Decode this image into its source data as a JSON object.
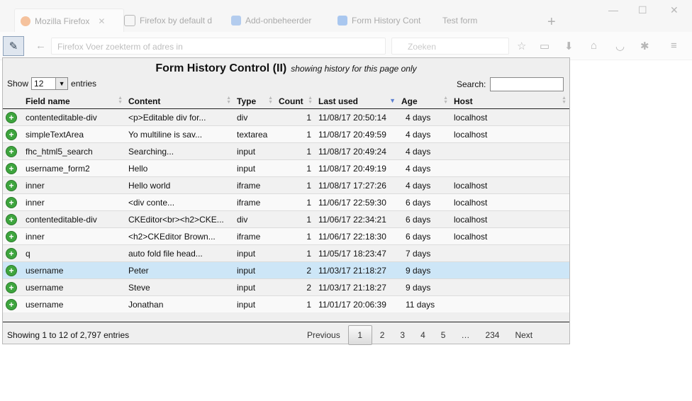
{
  "browser": {
    "tabs": [
      {
        "label": "Mozilla Firefox",
        "icon": "firefox-icon",
        "color": "#e66000"
      },
      {
        "label": "Firefox by default d",
        "icon": "page-icon",
        "color": "#444444"
      },
      {
        "label": "Add-onbeheerder",
        "icon": "puzzle-icon",
        "color": "#3a7bd5"
      },
      {
        "label": "Form History Cont",
        "icon": "form-history-icon",
        "color": "#1f6fd6"
      },
      {
        "label": "Test form",
        "icon": "",
        "color": ""
      }
    ],
    "url_placeholder": "Firefox   Voer zoekterm of adres in",
    "search_placeholder": "Zoeken"
  },
  "panel": {
    "title": "Form History Control (II)",
    "subtitle": "showing history for this page only",
    "show_label": "Show",
    "show_value": "12",
    "entries_label": "entries",
    "search_label": "Search:",
    "search_value": "",
    "columns": [
      "Field name",
      "Content",
      "Type",
      "Count",
      "Last used",
      "Age",
      "Host"
    ],
    "sorted_column": "Last used",
    "rows": [
      {
        "field": "contenteditable-div",
        "content": "<p>Editable div for...",
        "type": "div",
        "count": "1",
        "last_used": "11/08/17 20:50:14",
        "age": "4 days",
        "host": "localhost"
      },
      {
        "field": "simpleTextArea",
        "content": "Yo multiline is sav...",
        "type": "textarea",
        "count": "1",
        "last_used": "11/08/17 20:49:59",
        "age": "4 days",
        "host": "localhost"
      },
      {
        "field": "fhc_html5_search",
        "content": "Searching...",
        "type": "input",
        "count": "1",
        "last_used": "11/08/17 20:49:24",
        "age": "4 days",
        "host": ""
      },
      {
        "field": "username_form2",
        "content": "Hello",
        "type": "input",
        "count": "1",
        "last_used": "11/08/17 20:49:19",
        "age": "4 days",
        "host": ""
      },
      {
        "field": "inner",
        "content": "Hello world",
        "type": "iframe",
        "count": "1",
        "last_used": "11/08/17 17:27:26",
        "age": "4 days",
        "host": "localhost"
      },
      {
        "field": "inner",
        "content": "<div conte...",
        "type": "iframe",
        "count": "1",
        "last_used": "11/06/17 22:59:30",
        "age": "6 days",
        "host": "localhost"
      },
      {
        "field": "contenteditable-div",
        "content": "CKEditor<br><h2>CKE...",
        "type": "div",
        "count": "1",
        "last_used": "11/06/17 22:34:21",
        "age": "6 days",
        "host": "localhost"
      },
      {
        "field": "inner",
        "content": "<h2>CKEditor Brown...",
        "type": "iframe",
        "count": "1",
        "last_used": "11/06/17 22:18:30",
        "age": "6 days",
        "host": "localhost"
      },
      {
        "field": "q",
        "content": "auto fold file head...",
        "type": "input",
        "count": "1",
        "last_used": "11/05/17 18:23:47",
        "age": "7 days",
        "host": ""
      },
      {
        "field": "username",
        "content": "Peter",
        "type": "input",
        "count": "2",
        "last_used": "11/03/17 21:18:27",
        "age": "9 days",
        "host": ""
      },
      {
        "field": "username",
        "content": "Steve",
        "type": "input",
        "count": "2",
        "last_used": "11/03/17 21:18:27",
        "age": "9 days",
        "host": ""
      },
      {
        "field": "username",
        "content": "Jonathan",
        "type": "input",
        "count": "1",
        "last_used": "11/01/17 20:06:39",
        "age": "11 days",
        "host": ""
      }
    ],
    "selected_row": 9,
    "info": "Showing 1 to 12 of 2,797 entries",
    "pager": [
      "Previous",
      "1",
      "2",
      "3",
      "4",
      "5",
      "…",
      "234",
      "Next"
    ],
    "current_page": "1"
  }
}
